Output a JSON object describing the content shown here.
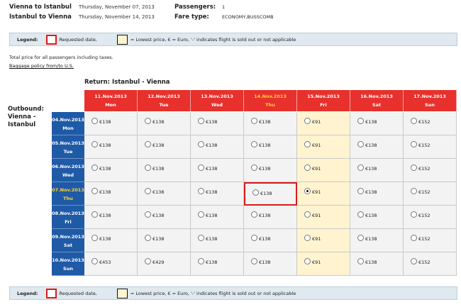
{
  "trip": [
    {
      "route": "Vienna to Istanbul",
      "date": "Thursday, November 07, 2013",
      "key": "Passengers:",
      "value": "1"
    },
    {
      "route": "Istanbul to Vienna",
      "date": "Thursday, November 14, 2013",
      "key": "Fare type:",
      "value": "ECONOMY,BUSSCOMB"
    }
  ],
  "legend": {
    "title": "Legend:",
    "requested": "Requested date,",
    "rest": "= Lowest price,  € = Euro, '-' indicates flight is sold out or not applicable"
  },
  "notes": {
    "taxes": "Total price for all passengers including taxes.",
    "baggage_link": "Baggage policy from/to U.S."
  },
  "return_title": "Return: Istanbul - Vienna",
  "outbound_label": [
    "Outbound:",
    "Vienna -",
    "Istanbul"
  ],
  "columns": [
    {
      "date": "11.Nov.2013",
      "day": "Mon"
    },
    {
      "date": "12.Nov.2013",
      "day": "Tue"
    },
    {
      "date": "13.Nov.2013",
      "day": "Wed"
    },
    {
      "date": "14.Nov.2013",
      "day": "Thu"
    },
    {
      "date": "15.Nov.2013",
      "day": "Fri"
    },
    {
      "date": "16.Nov.2013",
      "day": "Sat"
    },
    {
      "date": "17.Nov.2013",
      "day": "Sun"
    }
  ],
  "selected_column": 3,
  "lowest_column": 4,
  "rows": [
    {
      "date": "04.Nov.2013",
      "day": "Mon",
      "prices": [
        "€138",
        "€138",
        "€138",
        "€138",
        "€91",
        "€138",
        "€152"
      ]
    },
    {
      "date": "05.Nov.2013",
      "day": "Tue",
      "prices": [
        "€138",
        "€138",
        "€138",
        "€138",
        "€91",
        "€138",
        "€152"
      ]
    },
    {
      "date": "06.Nov.2013",
      "day": "Wed",
      "prices": [
        "€138",
        "€138",
        "€138",
        "€138",
        "€91",
        "€138",
        "€152"
      ]
    },
    {
      "date": "07.Nov.2013",
      "day": "Thu",
      "prices": [
        "€138",
        "€138",
        "€138",
        "€138",
        "€91",
        "€138",
        "€152"
      ]
    },
    {
      "date": "08.Nov.2013",
      "day": "Fri",
      "prices": [
        "€138",
        "€138",
        "€138",
        "€138",
        "€91",
        "€138",
        "€152"
      ]
    },
    {
      "date": "09.Nov.2013",
      "day": "Sat",
      "prices": [
        "€138",
        "€138",
        "€138",
        "€138",
        "€91",
        "€138",
        "€152"
      ]
    },
    {
      "date": "10.Nov.2013",
      "day": "Sun",
      "prices": [
        "€453",
        "€429",
        "€138",
        "€138",
        "€91",
        "€138",
        "€152"
      ]
    }
  ],
  "selected_row": 3,
  "checked": {
    "row": 3,
    "col": 4
  },
  "colors": {
    "header": "#e8302c",
    "row_header": "#1f5aa6",
    "lowest": "#fff4cf",
    "requested_border": "#d91c1c",
    "selected_text": "#ffd23e"
  }
}
